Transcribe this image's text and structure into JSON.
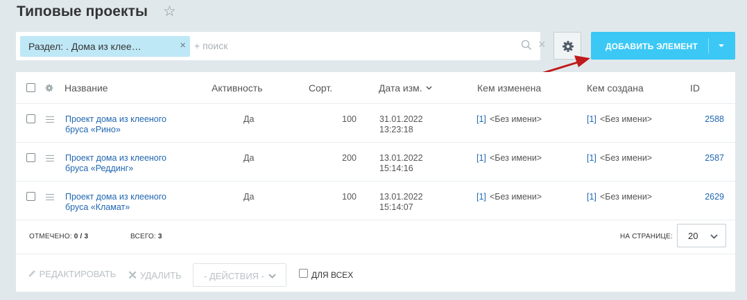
{
  "header": {
    "title": "Типовые проекты"
  },
  "filter": {
    "chip_label": "Раздел: . Дома из клее…",
    "search_placeholder": "+ поиск"
  },
  "toolbar": {
    "add_label": "ДОБАВИТЬ ЭЛЕМЕНТ"
  },
  "columns": {
    "name": "Название",
    "active": "Активность",
    "sort": "Сорт.",
    "date": "Дата изм.",
    "modified_by": "Кем изменена",
    "created_by": "Кем создана",
    "id": "ID"
  },
  "rows": [
    {
      "name1": "Проект дома из клееного",
      "name2": "бруса «Рино»",
      "active": "Да",
      "sort": "100",
      "date": "31.01.2022",
      "time": "13:23:18",
      "mod_link": "[1]",
      "mod_name": "<Без имени>",
      "cr_link": "[1]",
      "cr_name": "<Без имени>",
      "id": "2588"
    },
    {
      "name1": "Проект дома из клееного",
      "name2": "бруса «Реддинг»",
      "active": "Да",
      "sort": "200",
      "date": "13.01.2022",
      "time": "15:14:16",
      "mod_link": "[1]",
      "mod_name": "<Без имени>",
      "cr_link": "[1]",
      "cr_name": "<Без имени>",
      "id": "2587"
    },
    {
      "name1": "Проект дома из клееного",
      "name2": "бруса «Кламат»",
      "active": "Да",
      "sort": "100",
      "date": "13.01.2022",
      "time": "15:14:07",
      "mod_link": "[1]",
      "mod_name": "<Без имени>",
      "cr_link": "[1]",
      "cr_name": "<Без имени>",
      "id": "2629"
    }
  ],
  "footer": {
    "selected_label": "ОТМЕЧЕНО:",
    "selected_value": "0 / 3",
    "total_label": "ВСЕГО:",
    "total_value": "3",
    "per_page_label": "НА СТРАНИЦЕ:",
    "per_page_value": "20"
  },
  "actions": {
    "edit": "РЕДАКТИРОВАТЬ",
    "delete": "УДАЛИТЬ",
    "actions_select": "- ДЕЙСТВИЯ -",
    "for_all": "ДЛЯ ВСЕХ"
  },
  "colors": {
    "accent": "#3bc8f5",
    "chip": "#bfe8f7",
    "link": "#2067b0",
    "arrow": "#c01a1a",
    "background": "#e0e8ec"
  },
  "icons": [
    "star-icon",
    "close-icon",
    "search-icon",
    "gear-icon",
    "chevron-down-icon",
    "drag-handle-icon",
    "pencil-icon"
  ]
}
